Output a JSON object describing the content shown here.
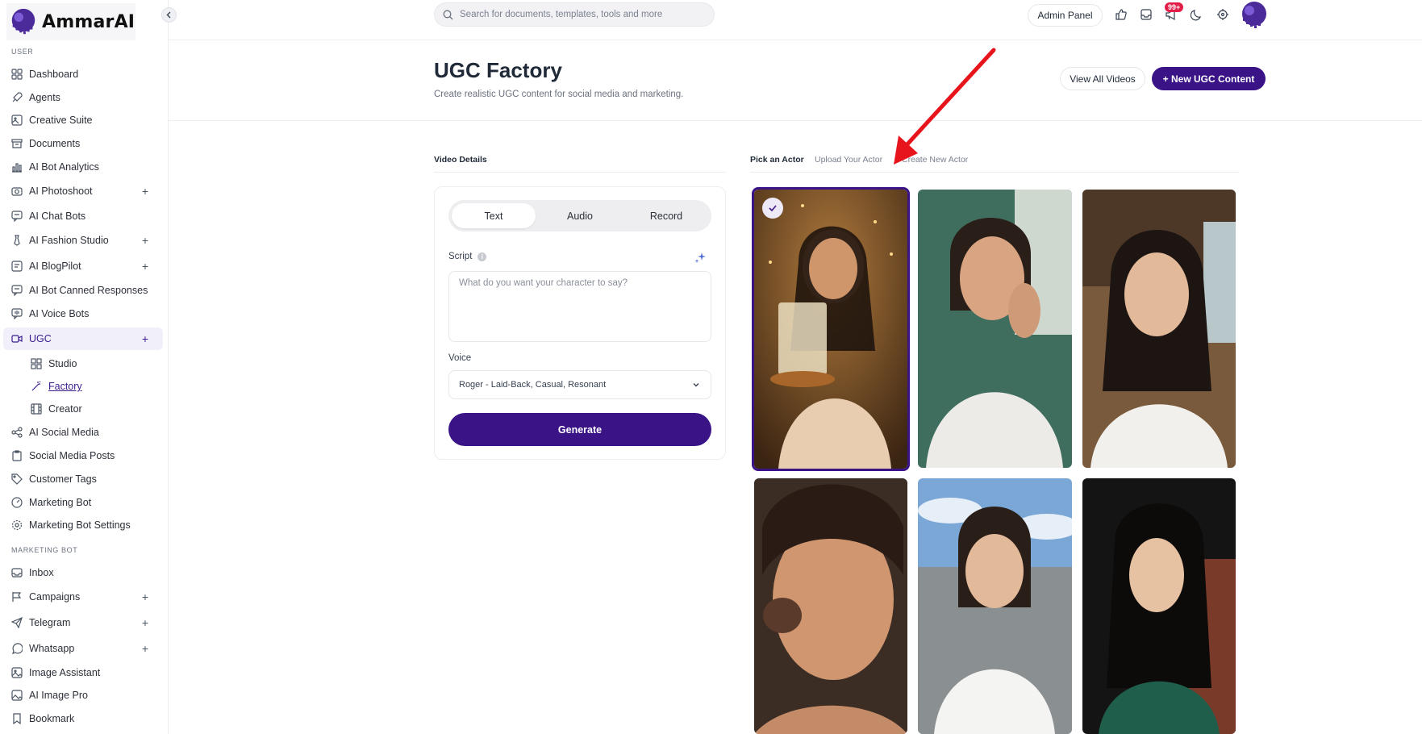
{
  "app": {
    "brand": "AmmarAI",
    "search_placeholder": "Search for documents, templates, tools and more",
    "admin_label": "Admin Panel",
    "notification_badge": "99+",
    "accent": "#3a1387"
  },
  "sidebar": {
    "section_user": "USER",
    "section_marketing": "MARKETING BOT",
    "items": [
      {
        "label": "Dashboard"
      },
      {
        "label": "Agents"
      },
      {
        "label": "Creative Suite"
      },
      {
        "label": "Documents"
      },
      {
        "label": "AI Bot Analytics"
      },
      {
        "label": "AI Photoshoot"
      },
      {
        "label": "AI Chat Bots"
      },
      {
        "label": "AI Fashion Studio"
      },
      {
        "label": "AI BlogPilot"
      },
      {
        "label": "AI Bot Canned Responses"
      },
      {
        "label": "AI Voice Bots"
      },
      {
        "label": "UGC"
      },
      {
        "label": "AI Social Media"
      },
      {
        "label": "Social Media Posts"
      },
      {
        "label": "Customer Tags"
      },
      {
        "label": "Marketing Bot"
      },
      {
        "label": "Marketing Bot Settings"
      },
      {
        "label": "Inbox"
      },
      {
        "label": "Campaigns"
      },
      {
        "label": "Telegram"
      },
      {
        "label": "Whatsapp"
      },
      {
        "label": "Image Assistant"
      },
      {
        "label": "AI Image Pro"
      },
      {
        "label": "Bookmark"
      }
    ],
    "ugc_sub": [
      {
        "label": "Studio"
      },
      {
        "label": "Factory"
      },
      {
        "label": "Creator"
      }
    ]
  },
  "header": {
    "title": "UGC Factory",
    "subtitle": "Create realistic UGC content for social media and marketing.",
    "view_all": "View All Videos",
    "new_content": "+ New UGC Content"
  },
  "details": {
    "label": "Video Details",
    "modes": [
      "Text",
      "Audio",
      "Record"
    ],
    "active_mode": "Text",
    "script_label": "Script",
    "script_placeholder": "What do you want your character to say?",
    "script_value": "",
    "voice_label": "Voice",
    "voice_value": "Roger - Laid-Back, Casual, Resonant",
    "generate": "Generate"
  },
  "actors": {
    "tabs": [
      "Pick an Actor",
      "Upload Your Actor",
      "Create New Actor"
    ],
    "active_tab": "Pick an Actor",
    "selected_index": 0
  }
}
